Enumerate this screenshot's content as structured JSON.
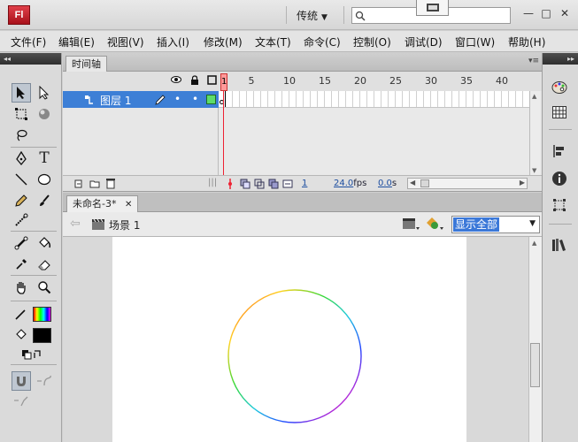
{
  "app": {
    "logo": "Fl",
    "workspace": "传统",
    "search_placeholder": ""
  },
  "window_controls": {
    "minimize": "—",
    "maximize": "□",
    "close": "✕"
  },
  "menu": [
    "文件(F)",
    "编辑(E)",
    "视图(V)",
    "插入(I)",
    "修改(M)",
    "文本(T)",
    "命令(C)",
    "控制(O)",
    "调试(D)",
    "窗口(W)",
    "帮助(H)"
  ],
  "timeline": {
    "tab": "时间轴",
    "ruler": [
      "1",
      "5",
      "10",
      "15",
      "20",
      "25",
      "30",
      "35",
      "40"
    ],
    "layer_name": "图层 1",
    "current_frame": "1",
    "fps": "24.0",
    "fps_unit": "fps",
    "time": "0.0",
    "time_unit": "s"
  },
  "document": {
    "tab": "未命名-3*",
    "tab_close": "✕",
    "scene": "场景 1",
    "zoom": "显示全部"
  },
  "colors": {
    "layer_highlight": "#3d7fd6",
    "playhead": "#e62633",
    "fill_color": "#000000",
    "stroke_color": "rainbow-gradient"
  },
  "tools": {
    "text_tool": "T"
  },
  "panels_collapse": "◂◂"
}
